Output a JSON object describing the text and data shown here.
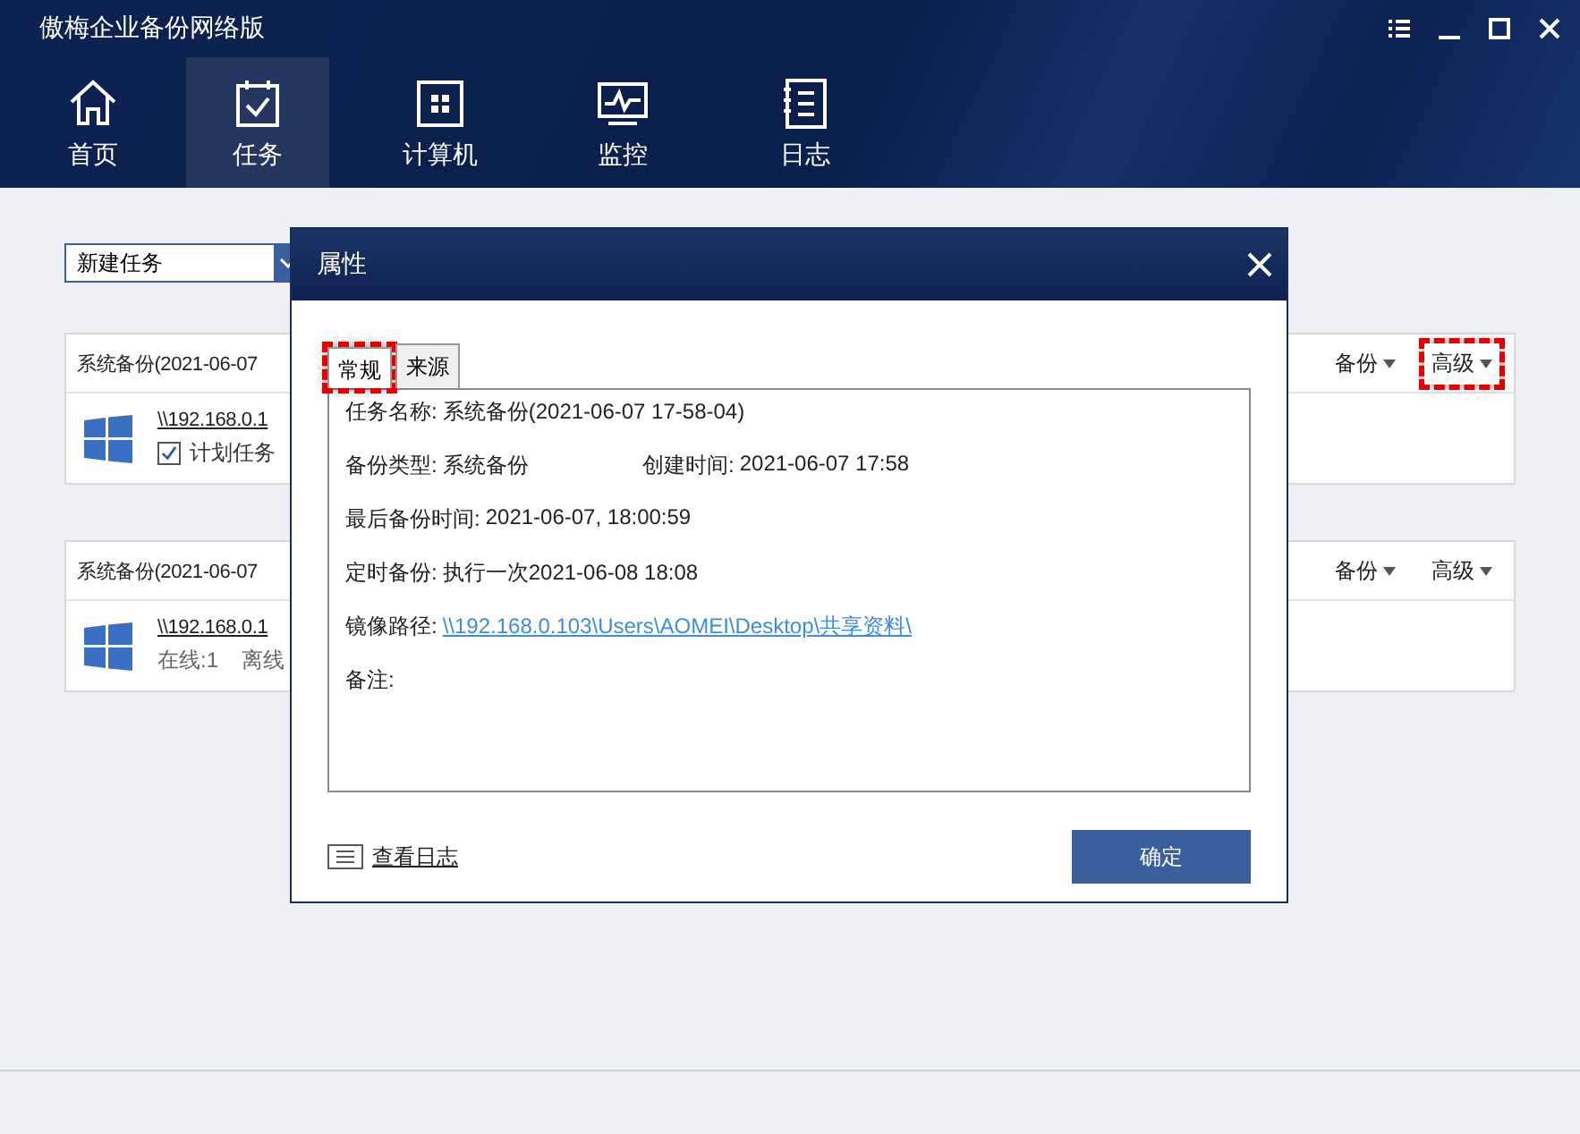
{
  "window": {
    "title": "傲梅企业备份网络版"
  },
  "nav": [
    {
      "label": "首页",
      "selected": false
    },
    {
      "label": "任务",
      "selected": true
    },
    {
      "label": "计算机",
      "selected": false
    },
    {
      "label": "监控",
      "selected": false
    },
    {
      "label": "日志",
      "selected": false
    }
  ],
  "task_dropdown": {
    "value": "新建任务"
  },
  "tasks": [
    {
      "title": "系统备份(2021-06-07",
      "host": "\\\\192.168.0.1",
      "menus": [
        {
          "label": "备份",
          "highlighted": false
        },
        {
          "label": "高级",
          "highlighted": true
        }
      ],
      "detail": {
        "kind": "checkbox",
        "label": "计划任务",
        "checked": true
      }
    },
    {
      "title": "系统备份(2021-06-07",
      "host": "\\\\192.168.0.1",
      "menus": [
        {
          "label": "备份",
          "highlighted": false
        },
        {
          "label": "高级",
          "highlighted": false
        }
      ],
      "detail": {
        "kind": "status",
        "items": [
          "在线:1",
          "离线"
        ]
      }
    }
  ],
  "dialog": {
    "title": "属性",
    "tabs": [
      {
        "label": "常规",
        "selected": true,
        "highlighted": true
      },
      {
        "label": "来源",
        "selected": false,
        "highlighted": false
      }
    ],
    "rows": [
      [
        {
          "label": "任务名称:",
          "value": "系统备份(2021-06-07 17-58-04)",
          "kind": "text"
        }
      ],
      [
        {
          "label": "备份类型:",
          "value": "系统备份",
          "kind": "text"
        },
        {
          "label": "创建时间:",
          "value": "2021-06-07 17:58",
          "kind": "text"
        }
      ],
      [
        {
          "label": "最后备份时间:",
          "value": "2021-06-07, 18:00:59",
          "kind": "text"
        }
      ],
      [
        {
          "label": "定时备份:",
          "value": "执行一次2021-06-08 18:08",
          "kind": "text"
        }
      ],
      [
        {
          "label": "镜像路径:",
          "value": "\\\\192.168.0.103\\Users\\AOMEI\\Desktop\\共享资料\\",
          "kind": "link"
        }
      ],
      [
        {
          "label": "备注:"
        }
      ]
    ],
    "log_link": "查看日志",
    "ok_button": "确定"
  }
}
